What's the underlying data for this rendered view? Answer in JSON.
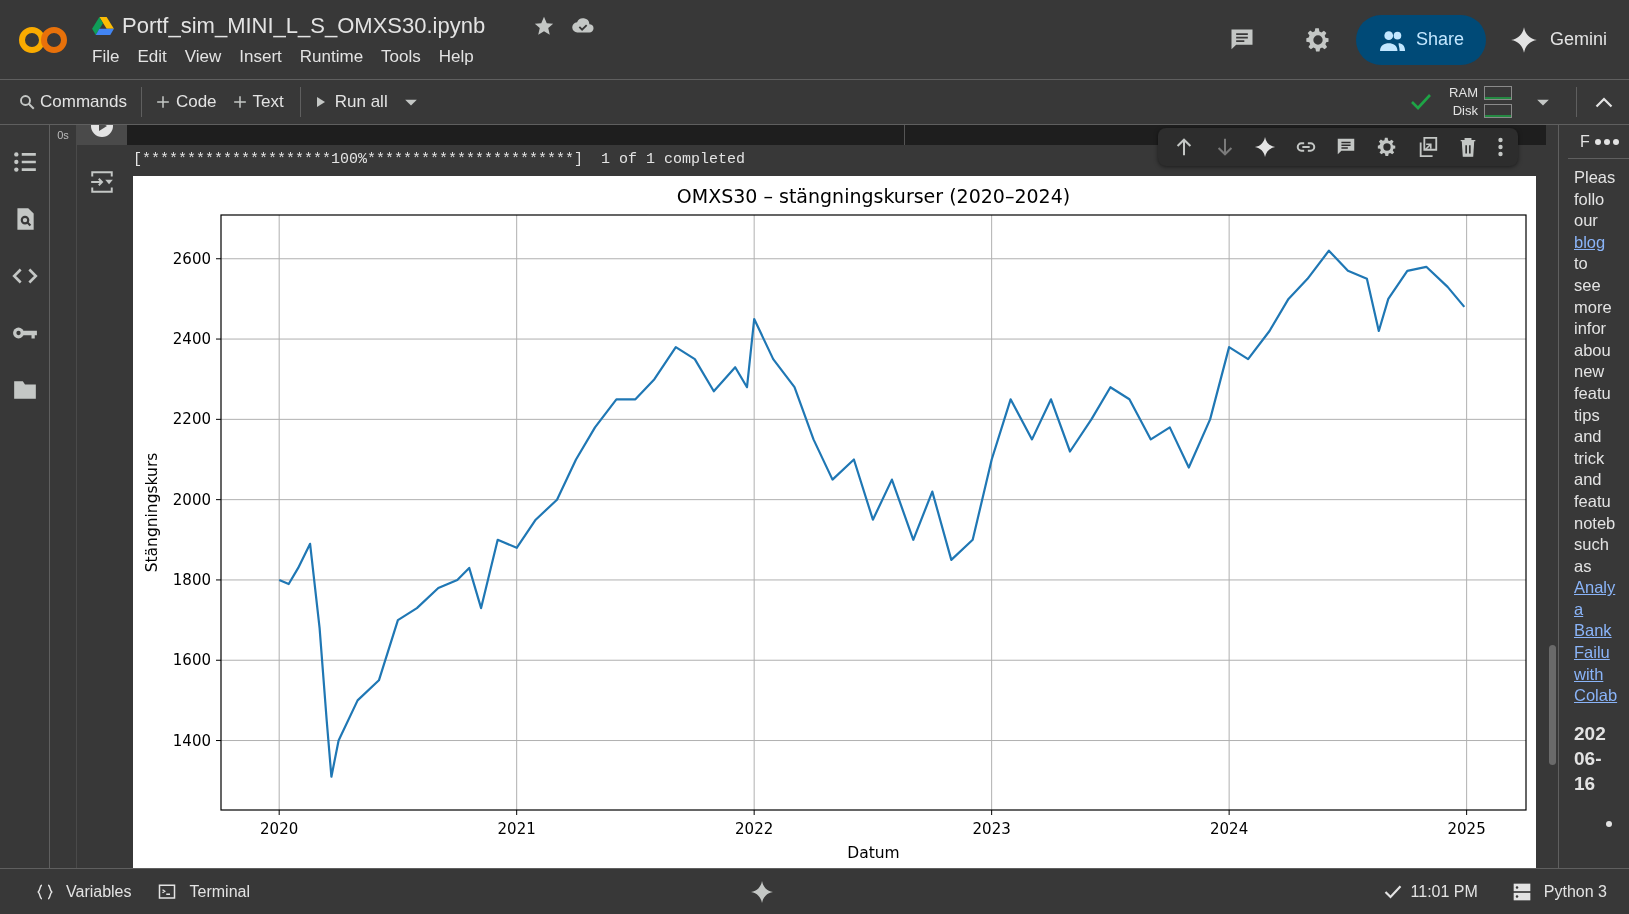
{
  "header": {
    "title": "Portf_sim_MINI_L_S_OMXS30.ipynb",
    "menu": [
      "File",
      "Edit",
      "View",
      "Insert",
      "Runtime",
      "Tools",
      "Help"
    ],
    "share_label": "Share",
    "gemini_label": "Gemini"
  },
  "toolbar": {
    "commands_label": "Commands",
    "add_code_label": "Code",
    "add_text_label": "Text",
    "run_all_label": "Run all",
    "connected": true,
    "ram_label": "RAM",
    "disk_label": "Disk"
  },
  "cell": {
    "timing": "0s",
    "output_text": "[*********************100%***********************]  1 of 1 completed",
    "chart_data": {
      "type": "line",
      "grid": true,
      "title": "OMXS30 – stängningskurser (2020–2024)",
      "xlabel": "Datum",
      "ylabel": "Stängningskurs",
      "xlim": [
        2019.755,
        2025.25
      ],
      "ylim": [
        1227,
        2709
      ],
      "xticks": [
        2020,
        2021,
        2022,
        2023,
        2024,
        2025
      ],
      "yticks": [
        1400,
        1600,
        1800,
        2000,
        2200,
        2400,
        2600
      ],
      "x": [
        2020.0,
        2020.04,
        2020.08,
        2020.13,
        2020.17,
        2020.2,
        2020.22,
        2020.25,
        2020.33,
        2020.42,
        2020.5,
        2020.58,
        2020.67,
        2020.75,
        2020.8,
        2020.85,
        2020.92,
        2021.0,
        2021.08,
        2021.17,
        2021.25,
        2021.33,
        2021.42,
        2021.5,
        2021.58,
        2021.67,
        2021.75,
        2021.83,
        2021.92,
        2021.97,
        2022.0,
        2022.08,
        2022.17,
        2022.25,
        2022.33,
        2022.42,
        2022.5,
        2022.58,
        2022.67,
        2022.75,
        2022.83,
        2022.92,
        2023.0,
        2023.08,
        2023.17,
        2023.25,
        2023.33,
        2023.42,
        2023.5,
        2023.58,
        2023.67,
        2023.75,
        2023.83,
        2023.92,
        2024.0,
        2024.08,
        2024.17,
        2024.25,
        2024.33,
        2024.42,
        2024.5,
        2024.58,
        2024.63,
        2024.67,
        2024.75,
        2024.83,
        2024.92,
        2024.99
      ],
      "series": [
        {
          "color": "#1f77b4",
          "values": [
            1800,
            1790,
            1830,
            1890,
            1680,
            1450,
            1310,
            1400,
            1500,
            1550,
            1700,
            1730,
            1780,
            1800,
            1830,
            1730,
            1900,
            1880,
            1950,
            2000,
            2100,
            2180,
            2250,
            2250,
            2300,
            2380,
            2350,
            2270,
            2330,
            2280,
            2450,
            2350,
            2280,
            2150,
            2050,
            2100,
            1950,
            2050,
            1900,
            2020,
            1850,
            1900,
            2100,
            2250,
            2150,
            2250,
            2120,
            2200,
            2280,
            2250,
            2150,
            2180,
            2080,
            2200,
            2380,
            2350,
            2420,
            2500,
            2550,
            2620,
            2570,
            2550,
            2420,
            2500,
            2570,
            2580,
            2530,
            2480
          ]
        }
      ]
    }
  },
  "side_panel": {
    "title": "F",
    "text_parts": [
      {
        "kind": "text",
        "text": "Pleas follo our"
      },
      {
        "kind": "link",
        "text": "blog"
      },
      {
        "kind": "text",
        "text": "to see more infor abou new featu tips and trick and featu noteb such as"
      },
      {
        "kind": "link",
        "text": "Analy"
      },
      {
        "kind": "link",
        "text": "a"
      },
      {
        "kind": "link",
        "text": "Bank"
      },
      {
        "kind": "link",
        "text": "Failu"
      },
      {
        "kind": "link",
        "text": "with"
      },
      {
        "kind": "link",
        "text": "Colab"
      }
    ],
    "date": "202 06- 16"
  },
  "status_bar": {
    "variables_label": "Variables",
    "terminal_label": "Terminal",
    "time": "11:01 PM",
    "runtime": "Python 3"
  }
}
